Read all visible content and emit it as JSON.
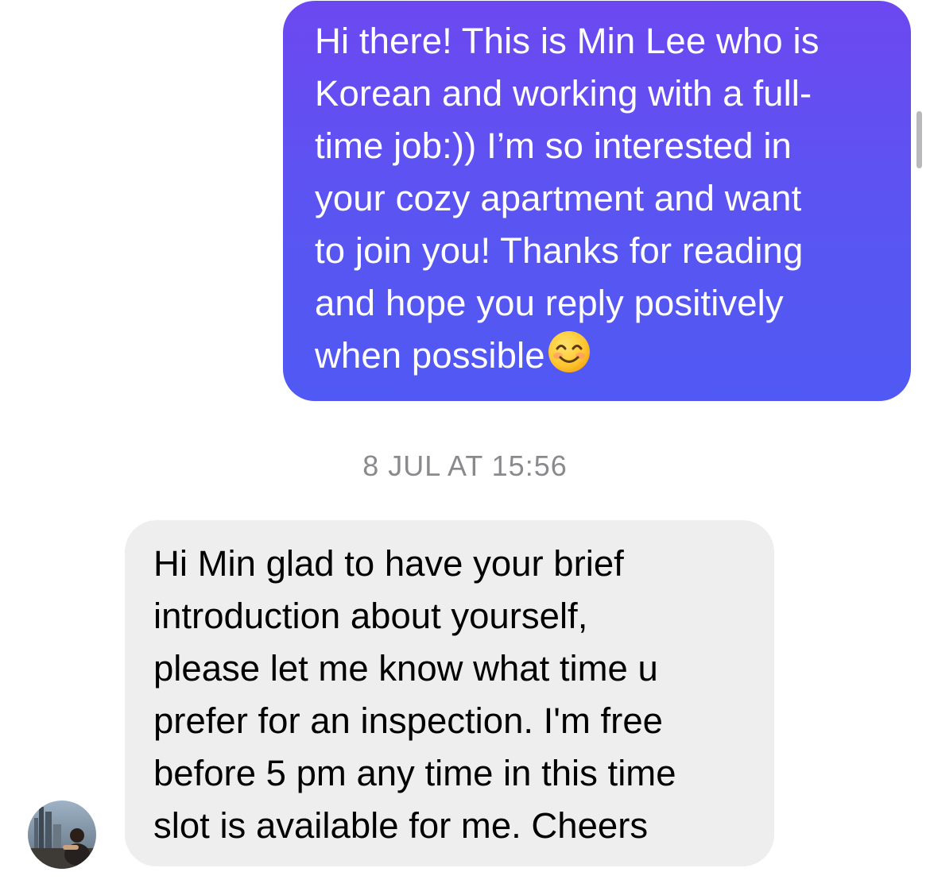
{
  "messages": [
    {
      "direction": "outgoing",
      "lines": [
        "Hi there! This is Min Lee who is",
        "Korean and working with a full-",
        "time job:)) I’m so interested in",
        "your cozy apartment and want",
        "to join you! Thanks for reading",
        "and hope you reply positively",
        "when possible"
      ],
      "trailing_emoji": "smiling-face-emoji"
    },
    {
      "direction": "incoming",
      "lines": [
        "Hi Min glad to have your brief",
        "introduction about yourself,",
        "please let me know what time u",
        "prefer for an inspection. I'm free",
        "before 5 pm any time in this time",
        "slot is available for me. Cheers"
      ]
    }
  ],
  "timestamp": "8 JUL AT 15:56",
  "colors": {
    "outgoing_bubble_top": "#6c48f1",
    "outgoing_bubble_bottom": "#5059f3",
    "incoming_bubble": "#eeeeef",
    "timestamp_text": "#8a8a8e"
  },
  "icons": {
    "sender_avatar": "avatar",
    "emoji": "smiling-face-emoji"
  }
}
